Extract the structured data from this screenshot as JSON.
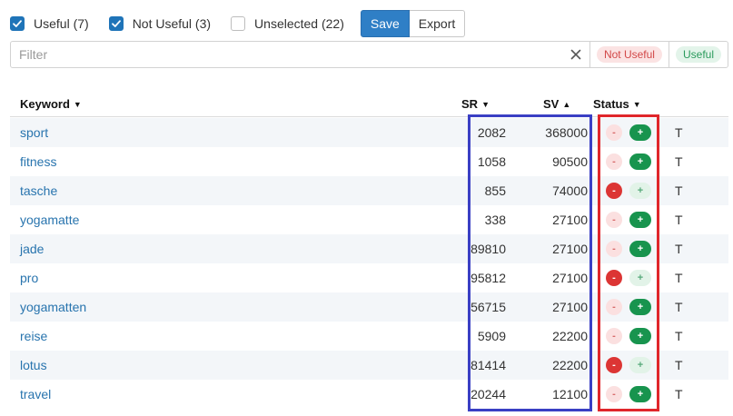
{
  "toolbar": {
    "useful": {
      "label": "Useful (7)",
      "checked": true
    },
    "not_useful": {
      "label": "Not Useful (3)",
      "checked": true
    },
    "unselected": {
      "label": "Unselected (22)",
      "checked": false
    },
    "save_label": "Save",
    "export_label": "Export"
  },
  "filter": {
    "placeholder": "Filter",
    "value": "",
    "clear_glyph": "×",
    "chip_not_useful": "Not Useful",
    "chip_useful": "Useful"
  },
  "table": {
    "headers": {
      "keyword": "Keyword",
      "sr": "SR",
      "sv": "SV",
      "status": "Status",
      "keyword_sort": "desc",
      "sr_sort": "desc",
      "sv_sort": "asc",
      "status_sort": "desc"
    },
    "rows": [
      {
        "keyword": "sport",
        "sr": "2082",
        "sv": "368000",
        "status": "useful",
        "t": "T"
      },
      {
        "keyword": "fitness",
        "sr": "1058",
        "sv": "90500",
        "status": "useful",
        "t": "T"
      },
      {
        "keyword": "tasche",
        "sr": "855",
        "sv": "74000",
        "status": "not-useful",
        "t": "T"
      },
      {
        "keyword": "yogamatte",
        "sr": "338",
        "sv": "27100",
        "status": "useful",
        "t": "T"
      },
      {
        "keyword": "jade",
        "sr": "89810",
        "sv": "27100",
        "status": "useful",
        "t": "T"
      },
      {
        "keyword": "pro",
        "sr": "95812",
        "sv": "27100",
        "status": "not-useful",
        "t": "T"
      },
      {
        "keyword": "yogamatten",
        "sr": "56715",
        "sv": "27100",
        "status": "useful",
        "t": "T"
      },
      {
        "keyword": "reise",
        "sr": "5909",
        "sv": "22200",
        "status": "useful",
        "t": "T"
      },
      {
        "keyword": "lotus",
        "sr": "81414",
        "sv": "22200",
        "status": "not-useful",
        "t": "T"
      },
      {
        "keyword": "travel",
        "sr": "20244",
        "sv": "12100",
        "status": "useful",
        "t": "T"
      }
    ],
    "minus_glyph": "-",
    "plus_glyph": "+"
  },
  "colors": {
    "primary": "#2f7fc6",
    "link": "#2874ae",
    "useful_dark": "#18944e",
    "not_useful_dark": "#dc3534",
    "annotation_blue": "#3a3fc4",
    "annotation_red": "#e0262b"
  }
}
